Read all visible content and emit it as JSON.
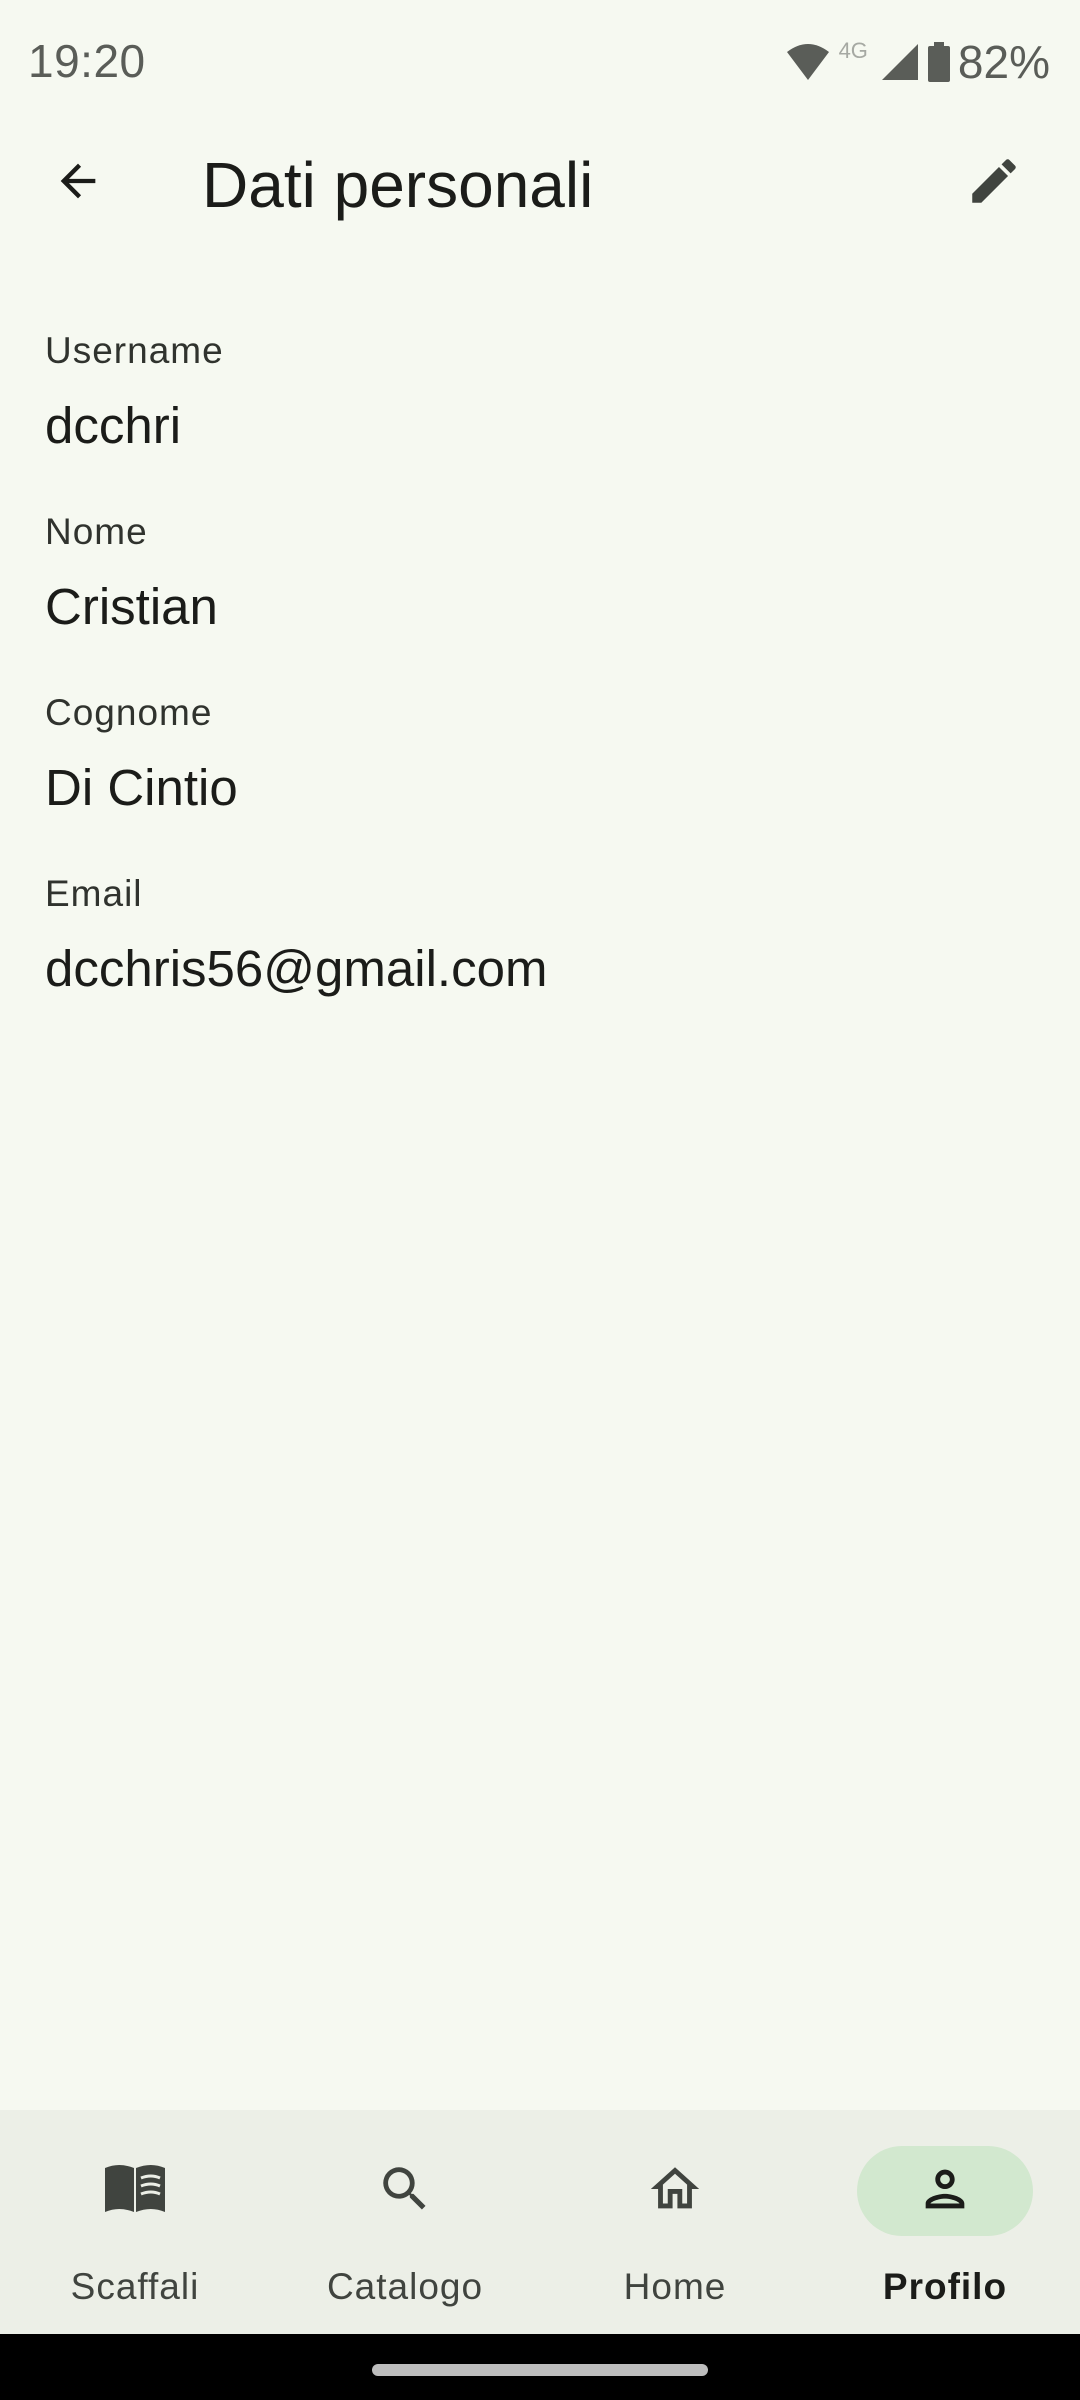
{
  "status_bar": {
    "time": "19:20",
    "network": "4G",
    "battery": "82%"
  },
  "app_bar": {
    "title": "Dati personali",
    "back_icon": "arrow-back-icon",
    "edit_icon": "pencil-icon"
  },
  "fields": [
    {
      "label": "Username",
      "value": "dcchri"
    },
    {
      "label": "Nome",
      "value": "Cristian"
    },
    {
      "label": "Cognome",
      "value": "Di Cintio"
    },
    {
      "label": "Email",
      "value": "dcchris56@gmail.com"
    }
  ],
  "bottom_nav": {
    "items": [
      {
        "label": "Scaffali",
        "icon": "book-icon",
        "active": false
      },
      {
        "label": "Catalogo",
        "icon": "search-icon",
        "active": false
      },
      {
        "label": "Home",
        "icon": "home-icon",
        "active": false
      },
      {
        "label": "Profilo",
        "icon": "person-icon",
        "active": true
      }
    ]
  },
  "colors": {
    "background": "#f6f9f1",
    "nav_background": "#ecefe7",
    "active_pill": "#d2e8cf",
    "text_primary": "#1b1c19"
  }
}
